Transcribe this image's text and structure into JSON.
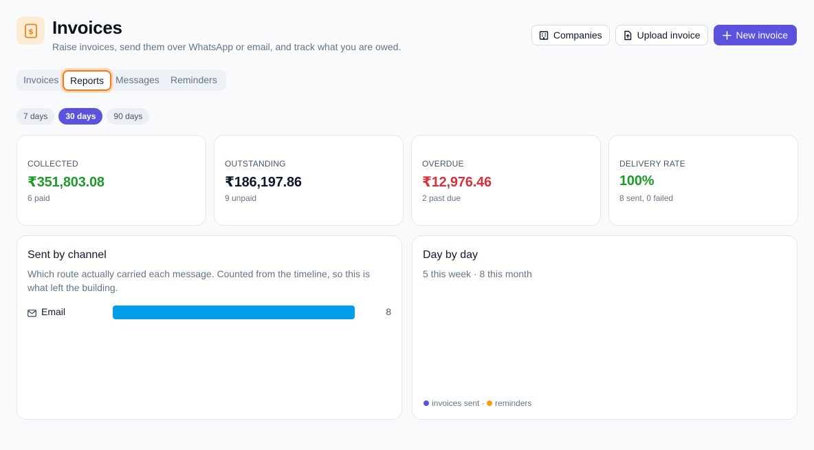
{
  "header": {
    "title": "Invoices",
    "subtitle": "Raise invoices, send them over WhatsApp or email, and track what you are owed.",
    "icon": "invoice-icon",
    "actions": {
      "companies": "Companies",
      "upload": "Upload invoice",
      "new_invoice": "New invoice"
    }
  },
  "tabs": [
    "Invoices",
    "Reports",
    "Messages",
    "Reminders"
  ],
  "active_tab": "Reports",
  "ranges": [
    "7 days",
    "30 days",
    "90 days"
  ],
  "active_range": "30 days",
  "stats": [
    {
      "label": "COLLECTED",
      "value": "₹351,803.08",
      "sub": "6 paid",
      "color": "#1e9a2b"
    },
    {
      "label": "OUTSTANDING",
      "value": "₹186,197.86",
      "sub": "9 unpaid",
      "color": "#0f172a"
    },
    {
      "label": "OVERDUE",
      "value": "₹12,976.46",
      "sub": "2 past due",
      "color": "#dc2f3a"
    },
    {
      "label": "DELIVERY RATE",
      "value": "100%",
      "sub": "8 sent, 0 failed",
      "color": "#1e9a2b"
    }
  ],
  "channel_panel": {
    "title": "Sent by channel",
    "description_line1": "Which route actually carried each message. Counted from the timeline, so this is",
    "description_line2": "what left the building.",
    "channels": [
      {
        "label": "Email",
        "icon": "mail-icon",
        "count": "8",
        "fraction": 1.0,
        "color": "#039eea"
      }
    ]
  },
  "day_panel": {
    "title": "Day by day",
    "summary": "5 this week · 8 this month",
    "legend": [
      {
        "label": "invoices sent",
        "color": "#5b53de"
      },
      {
        "label": "reminders",
        "color": "#f59e0b"
      }
    ],
    "legend_separator": " · "
  },
  "colors": {
    "accent": "#5b53de",
    "active_tab_ring": "#f07a1c",
    "email_bar": "#039eea"
  }
}
